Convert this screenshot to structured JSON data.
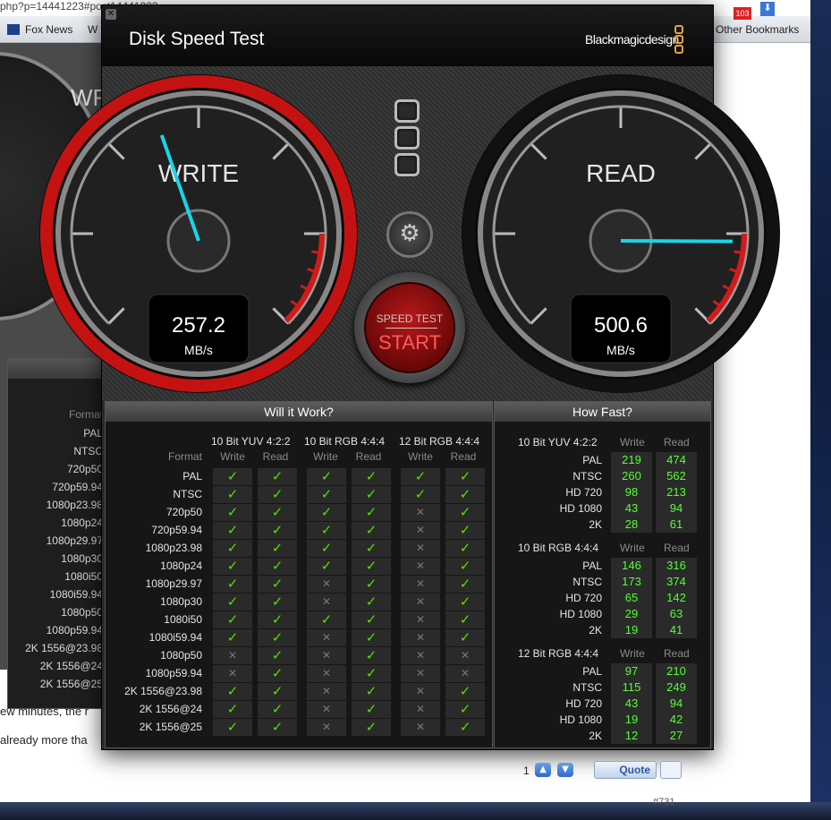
{
  "browser": {
    "url_fragment": "php?p=14441223#post14441223",
    "bookmarks": [
      {
        "label": "Fox News"
      },
      {
        "label": "W"
      },
      {
        "label": "Other Bookmarks"
      }
    ],
    "badge_count": "103",
    "page_text": {
      "line1": "ew minutes, the r",
      "line2": "already more tha"
    },
    "pagination_number": "1",
    "quote_label": "Quote",
    "post_number": "#731"
  },
  "background_app": {
    "gauge_label": "WR",
    "formats_header": "Format",
    "formats": [
      "PAL",
      "NTSC",
      "720p50",
      "720p59.94",
      "1080p23.98",
      "1080p24",
      "1080p29.97",
      "1080p30",
      "1080i50",
      "1080i59.94",
      "1080p50",
      "1080p59.94",
      "2K 1556@23.98",
      "2K 1556@24",
      "2K 1556@25"
    ]
  },
  "app": {
    "title": "Disk Speed Test",
    "brand": "Blackmagicdesign",
    "brand_color": "#e3a340",
    "write_gauge": {
      "label": "WRITE",
      "value": "257.2",
      "unit": "MB/s",
      "max": 600
    },
    "read_gauge": {
      "label": "READ",
      "value": "500.6",
      "unit": "MB/s",
      "max": 600
    },
    "start_button": {
      "small": "SPEED TEST",
      "big": "START"
    },
    "settings_icon": "gear-icon",
    "will_it_work": {
      "title": "Will it Work?",
      "format_header": "Format",
      "groups": [
        "10 Bit YUV 4:2:2",
        "10 Bit RGB 4:4:4",
        "12 Bit RGB 4:4:4"
      ],
      "col_write": "Write",
      "col_read": "Read",
      "ok_glyph": "✓",
      "no_glyph": "✕",
      "rows": [
        {
          "format": "PAL",
          "cells": [
            1,
            1,
            1,
            1,
            1,
            1
          ]
        },
        {
          "format": "NTSC",
          "cells": [
            1,
            1,
            1,
            1,
            1,
            1
          ]
        },
        {
          "format": "720p50",
          "cells": [
            1,
            1,
            1,
            1,
            0,
            1
          ]
        },
        {
          "format": "720p59.94",
          "cells": [
            1,
            1,
            1,
            1,
            0,
            1
          ]
        },
        {
          "format": "1080p23.98",
          "cells": [
            1,
            1,
            1,
            1,
            0,
            1
          ]
        },
        {
          "format": "1080p24",
          "cells": [
            1,
            1,
            1,
            1,
            0,
            1
          ]
        },
        {
          "format": "1080p29.97",
          "cells": [
            1,
            1,
            0,
            1,
            0,
            1
          ]
        },
        {
          "format": "1080p30",
          "cells": [
            1,
            1,
            0,
            1,
            0,
            1
          ]
        },
        {
          "format": "1080i50",
          "cells": [
            1,
            1,
            1,
            1,
            0,
            1
          ]
        },
        {
          "format": "1080i59.94",
          "cells": [
            1,
            1,
            0,
            1,
            0,
            1
          ]
        },
        {
          "format": "1080p50",
          "cells": [
            0,
            1,
            0,
            1,
            0,
            0
          ]
        },
        {
          "format": "1080p59.94",
          "cells": [
            0,
            1,
            0,
            1,
            0,
            0
          ]
        },
        {
          "format": "2K 1556@23.98",
          "cells": [
            1,
            1,
            0,
            1,
            0,
            1
          ]
        },
        {
          "format": "2K 1556@24",
          "cells": [
            1,
            1,
            0,
            1,
            0,
            1
          ]
        },
        {
          "format": "2K 1556@25",
          "cells": [
            1,
            1,
            0,
            1,
            0,
            1
          ]
        }
      ]
    },
    "how_fast": {
      "title": "How Fast?",
      "col_write": "Write",
      "col_read": "Read",
      "sections": [
        {
          "name": "10 Bit YUV 4:2:2",
          "rows": [
            {
              "format": "PAL",
              "write": "219",
              "read": "474"
            },
            {
              "format": "NTSC",
              "write": "260",
              "read": "562"
            },
            {
              "format": "HD 720",
              "write": "98",
              "read": "213"
            },
            {
              "format": "HD 1080",
              "write": "43",
              "read": "94"
            },
            {
              "format": "2K",
              "write": "28",
              "read": "61"
            }
          ]
        },
        {
          "name": "10 Bit RGB 4:4:4",
          "rows": [
            {
              "format": "PAL",
              "write": "146",
              "read": "316"
            },
            {
              "format": "NTSC",
              "write": "173",
              "read": "374"
            },
            {
              "format": "HD 720",
              "write": "65",
              "read": "142"
            },
            {
              "format": "HD 1080",
              "write": "29",
              "read": "63"
            },
            {
              "format": "2K",
              "write": "19",
              "read": "41"
            }
          ]
        },
        {
          "name": "12 Bit RGB 4:4:4",
          "rows": [
            {
              "format": "PAL",
              "write": "97",
              "read": "210"
            },
            {
              "format": "NTSC",
              "write": "115",
              "read": "249"
            },
            {
              "format": "HD 720",
              "write": "43",
              "read": "94"
            },
            {
              "format": "HD 1080",
              "write": "19",
              "read": "42"
            },
            {
              "format": "2K",
              "write": "12",
              "read": "27"
            }
          ]
        }
      ]
    }
  }
}
